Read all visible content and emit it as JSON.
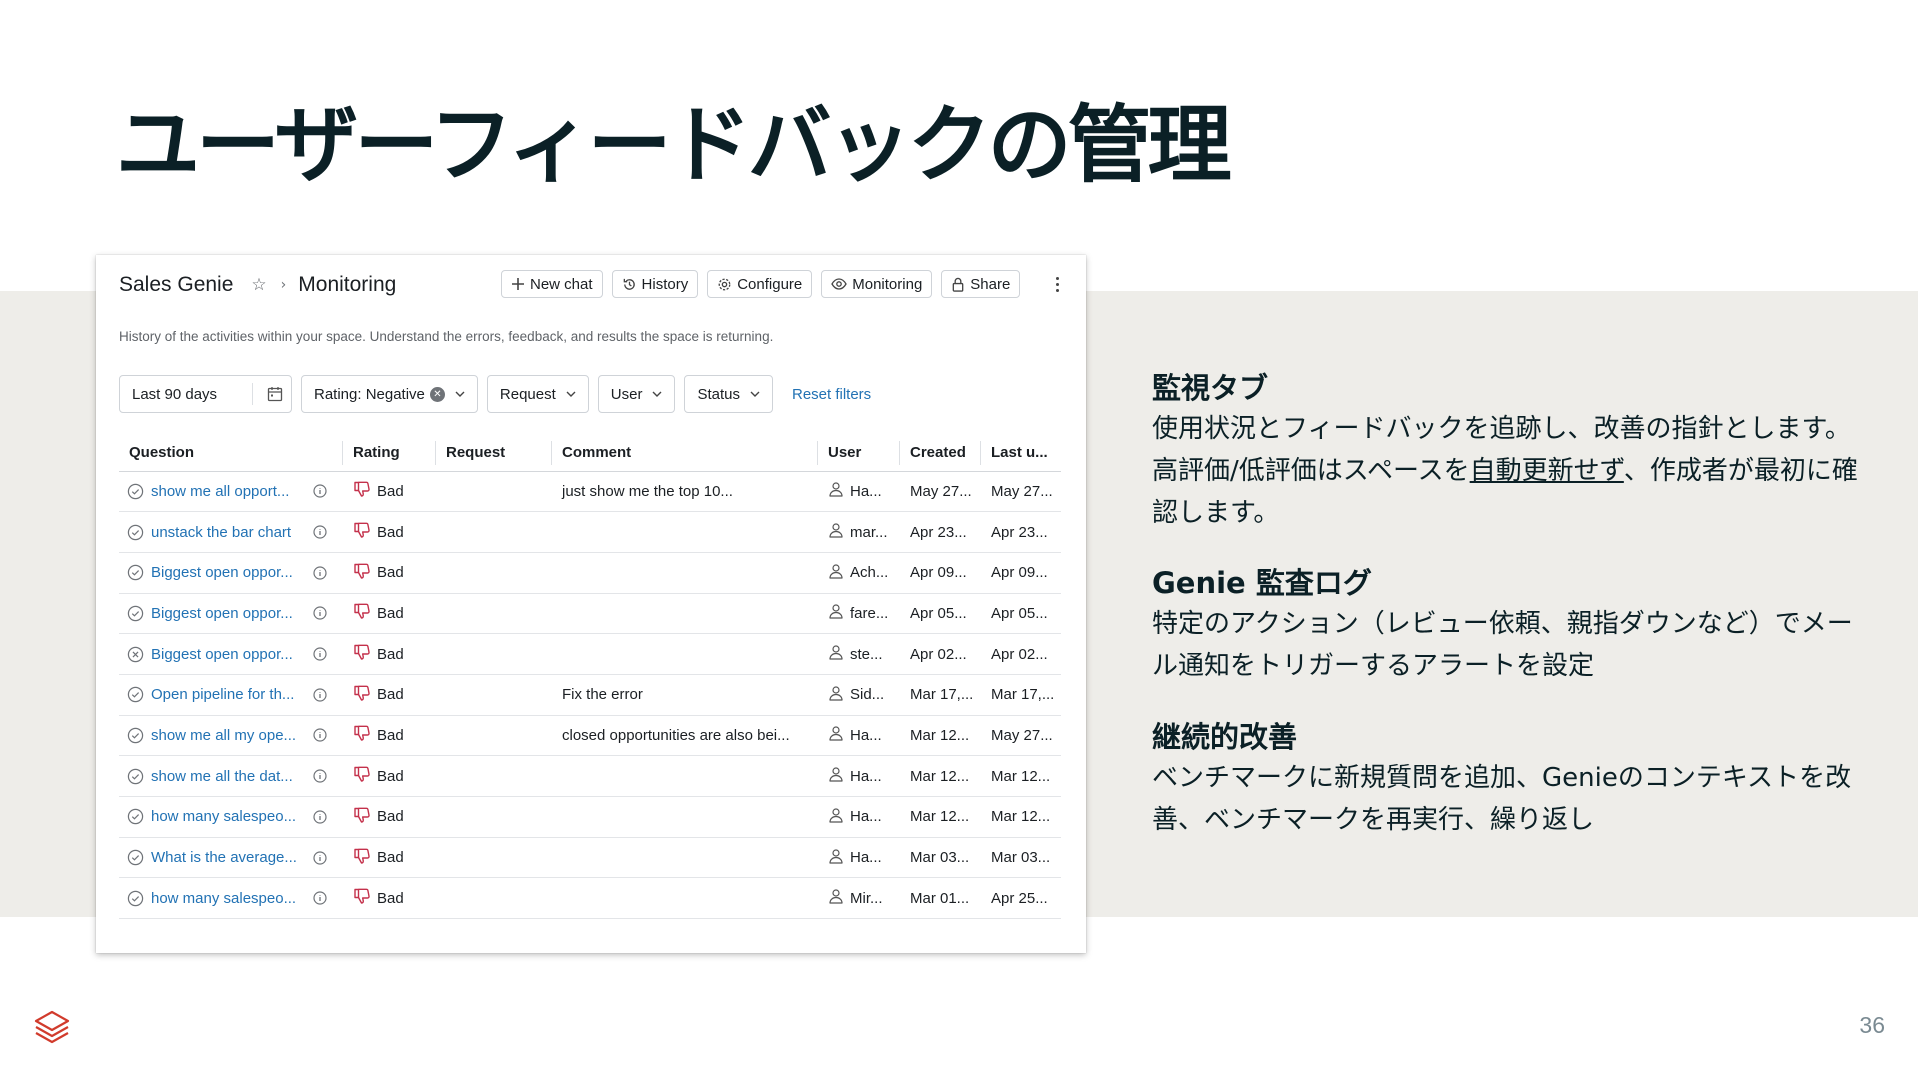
{
  "slide": {
    "title": "ユーザーフィードバックの管理",
    "page_number": "36"
  },
  "app": {
    "name": "Sales Genie",
    "breadcrumb_sep": "›",
    "page": "Monitoring",
    "toolbar": [
      {
        "label": "New chat",
        "icon": "plus-icon"
      },
      {
        "label": "History",
        "icon": "history-icon"
      },
      {
        "label": "Configure",
        "icon": "gear-icon"
      },
      {
        "label": "Monitoring",
        "icon": "eye-icon"
      },
      {
        "label": "Share",
        "icon": "lock-icon"
      }
    ],
    "description": "History of the activities within your space. Understand the errors, feedback, and results the space is returning.",
    "filters": {
      "date": "Last 90 days",
      "rating": "Rating: Negative",
      "request": "Request",
      "user": "User",
      "status": "Status",
      "reset": "Reset filters"
    },
    "table": {
      "headers": [
        "Question",
        "Rating",
        "Request",
        "Comment",
        "User",
        "Created",
        "Last u..."
      ],
      "rows": [
        {
          "status": "check",
          "question": "show me all opport...",
          "rating": "Bad",
          "request": "",
          "comment": "just show me the top 10...",
          "user": "Ha...",
          "created": "May 27...",
          "last": "May 27..."
        },
        {
          "status": "check",
          "question": "unstack the bar chart",
          "rating": "Bad",
          "request": "",
          "comment": "",
          "user": "mar...",
          "created": "Apr 23...",
          "last": "Apr 23..."
        },
        {
          "status": "check",
          "question": "Biggest open oppor...",
          "rating": "Bad",
          "request": "",
          "comment": "",
          "user": "Ach...",
          "created": "Apr 09...",
          "last": "Apr 09..."
        },
        {
          "status": "check",
          "question": "Biggest open oppor...",
          "rating": "Bad",
          "request": "",
          "comment": "",
          "user": "fare...",
          "created": "Apr 05...",
          "last": "Apr 05..."
        },
        {
          "status": "error",
          "question": "Biggest open oppor...",
          "rating": "Bad",
          "request": "",
          "comment": "",
          "user": "ste...",
          "created": "Apr 02...",
          "last": "Apr 02..."
        },
        {
          "status": "check",
          "question": "Open pipeline for th...",
          "rating": "Bad",
          "request": "",
          "comment": "Fix the error",
          "user": "Sid...",
          "created": "Mar 17,...",
          "last": "Mar 17,..."
        },
        {
          "status": "check",
          "question": "show me all my ope...",
          "rating": "Bad",
          "request": "",
          "comment": "closed opportunities are also bei...",
          "user": "Ha...",
          "created": "Mar 12...",
          "last": "May 27..."
        },
        {
          "status": "check",
          "question": "show me all the dat...",
          "rating": "Bad",
          "request": "",
          "comment": "",
          "user": "Ha...",
          "created": "Mar 12...",
          "last": "Mar 12..."
        },
        {
          "status": "check",
          "question": "how many salespeo...",
          "rating": "Bad",
          "request": "",
          "comment": "",
          "user": "Ha...",
          "created": "Mar 12...",
          "last": "Mar 12..."
        },
        {
          "status": "check",
          "question": "What is the average...",
          "rating": "Bad",
          "request": "",
          "comment": "",
          "user": "Ha...",
          "created": "Mar 03...",
          "last": "Mar 03..."
        },
        {
          "status": "check",
          "question": "how many salespeo...",
          "rating": "Bad",
          "request": "",
          "comment": "",
          "user": "Mir...",
          "created": "Mar 01...",
          "last": "Apr 25..."
        }
      ]
    }
  },
  "sections": [
    {
      "heading": "監視タブ",
      "body_before": "使用状況とフィードバックを追跡し、改善の指針とします。高評価/低評価はスペースを",
      "body_underlined": "自動更新せず",
      "body_after": "、作成者が最初に確認します。"
    },
    {
      "heading": "Genie 監査ログ",
      "body": "特定のアクション（レビュー依頼、親指ダウンなど）でメール通知をトリガーするアラートを設定"
    },
    {
      "heading": "継続的改善",
      "body": "ベンチマークに新規質問を追加、Genieのコンテキストを改善、ベンチマークを再実行、繰り返し"
    }
  ],
  "colors": {
    "link": "#2272b4",
    "bad_rating": "#c4314b",
    "band": "#eeede9",
    "title": "#0b2026",
    "logo": "#d13b2c"
  }
}
